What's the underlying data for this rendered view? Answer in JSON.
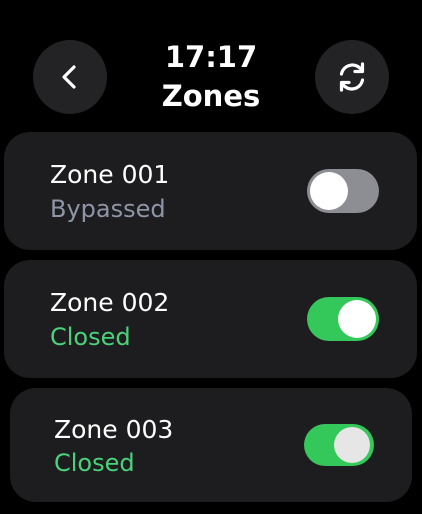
{
  "header": {
    "time": "17:17",
    "title": "Zones",
    "back_icon": "chevron-left-icon",
    "refresh_icon": "refresh-icon"
  },
  "zones": [
    {
      "name": "Zone 001",
      "status": "Bypassed",
      "toggle_on": false
    },
    {
      "name": "Zone 002",
      "status": "Closed",
      "toggle_on": true
    },
    {
      "name": "Zone 003",
      "status": "Closed",
      "toggle_on": true
    }
  ],
  "colors": {
    "background": "#000000",
    "card": "#1d1d1f",
    "button": "#232325",
    "toggle_on": "#34c759",
    "toggle_off": "#8d8e93",
    "status_closed": "#4ad27a",
    "status_bypassed": "#8e95a6"
  }
}
